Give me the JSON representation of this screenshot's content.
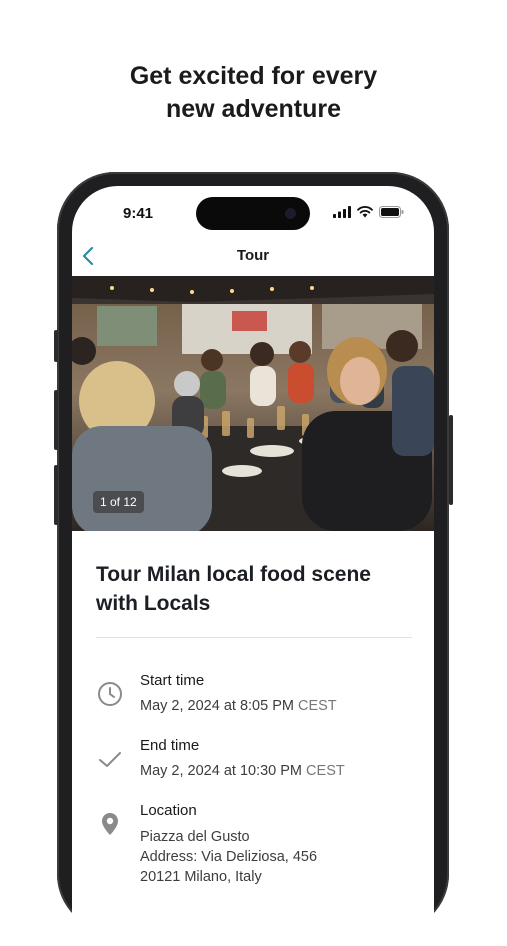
{
  "promo": {
    "line1": "Get excited for every",
    "line2": "new adventure"
  },
  "status_bar": {
    "time": "9:41",
    "icons": [
      "signal-icon",
      "wifi-icon",
      "battery-icon"
    ]
  },
  "nav": {
    "back_icon": "chevron-left-icon",
    "title": "Tour"
  },
  "gallery": {
    "counter": "1 of 12"
  },
  "tour": {
    "title": "Tour Milan local food scene with Locals",
    "start": {
      "icon": "clock-icon",
      "label": "Start time",
      "value": "May 2, 2024 at 8:05 PM",
      "timezone": "CEST"
    },
    "end": {
      "icon": "check-icon",
      "label": "End time",
      "value": "May 2, 2024 at 10:30 PM",
      "timezone": "CEST"
    },
    "location": {
      "icon": "location-pin-icon",
      "label": "Location",
      "lines": [
        "Piazza del Gusto",
        "Address: Via Deliziosa, 456",
        "20121 Milano, Italy"
      ]
    }
  },
  "colors": {
    "accent": "#2a8fa6",
    "icon_gray": "#8a8a8a",
    "text_dark": "#1b1f24"
  }
}
